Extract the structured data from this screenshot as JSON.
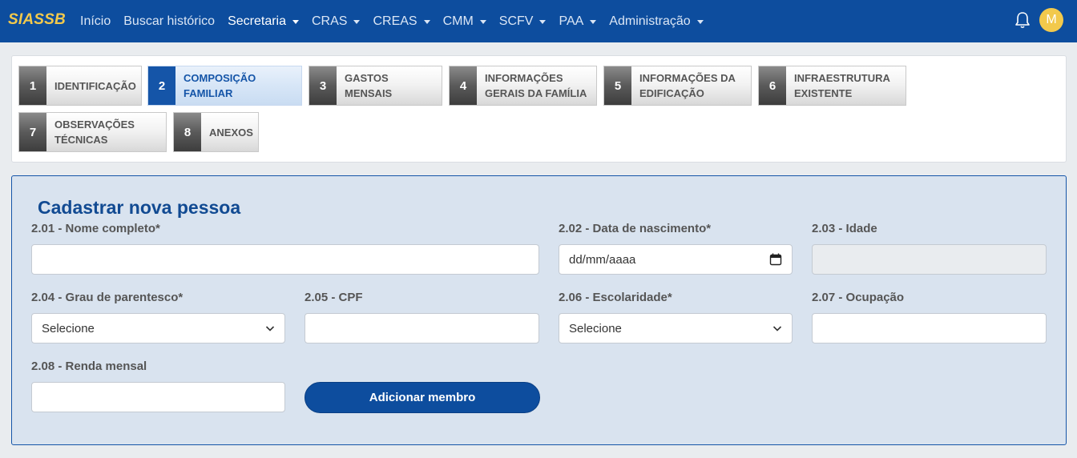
{
  "navbar": {
    "brand": "SIASSB",
    "items": [
      {
        "label": "Início",
        "dropdown": false,
        "active": false
      },
      {
        "label": "Buscar histórico",
        "dropdown": false,
        "active": false
      },
      {
        "label": "Secretaria",
        "dropdown": true,
        "active": true
      },
      {
        "label": "CRAS",
        "dropdown": true,
        "active": false
      },
      {
        "label": "CREAS",
        "dropdown": true,
        "active": false
      },
      {
        "label": "CMM",
        "dropdown": true,
        "active": false
      },
      {
        "label": "SCFV",
        "dropdown": true,
        "active": false
      },
      {
        "label": "PAA",
        "dropdown": true,
        "active": false
      },
      {
        "label": "Administração",
        "dropdown": true,
        "active": false
      }
    ],
    "notification_icon": "bell-icon",
    "avatar_initial": "M"
  },
  "steps": [
    {
      "num": "1",
      "line1": "IDENTIFICAÇÃO",
      "line2": ""
    },
    {
      "num": "2",
      "line1": "COMPOSIÇÃO",
      "line2": "FAMILIAR"
    },
    {
      "num": "3",
      "line1": "GASTOS MENSAIS",
      "line2": ""
    },
    {
      "num": "4",
      "line1": "INFORMAÇÕES",
      "line2": "GERAIS DA FAMÍLIA"
    },
    {
      "num": "5",
      "line1": "INFORMAÇÕES DA",
      "line2": "EDIFICAÇÃO"
    },
    {
      "num": "6",
      "line1": "INFRAESTRUTURA",
      "line2": "EXISTENTE"
    },
    {
      "num": "7",
      "line1": "OBSERVAÇÕES",
      "line2": "TÉCNICAS"
    },
    {
      "num": "8",
      "line1": "ANEXOS",
      "line2": ""
    }
  ],
  "active_step": "2",
  "form": {
    "title": "Cadastrar nova pessoa",
    "fields": {
      "nome": {
        "label": "2.01 - Nome completo*",
        "value": ""
      },
      "nascimento": {
        "label": "2.02 - Data de nascimento*",
        "value": "dd/mm/aaaa"
      },
      "idade": {
        "label": "2.03 - Idade",
        "value": ""
      },
      "parentesco": {
        "label": "2.04 - Grau de parentesco*",
        "value": "Selecione"
      },
      "cpf": {
        "label": "2.05 - CPF",
        "value": ""
      },
      "escolaridade": {
        "label": "2.06 - Escolaridade*",
        "value": "Selecione"
      },
      "ocupacao": {
        "label": "2.07 - Ocupação",
        "value": ""
      },
      "renda": {
        "label": "2.08 - Renda mensal",
        "value": ""
      }
    },
    "submit_label": "Adicionar membro"
  },
  "colors": {
    "navbar": "#0d4d9e",
    "brand": "#f2c94c",
    "active_step": "#1555a8",
    "form_bg": "#d9e3ef"
  }
}
